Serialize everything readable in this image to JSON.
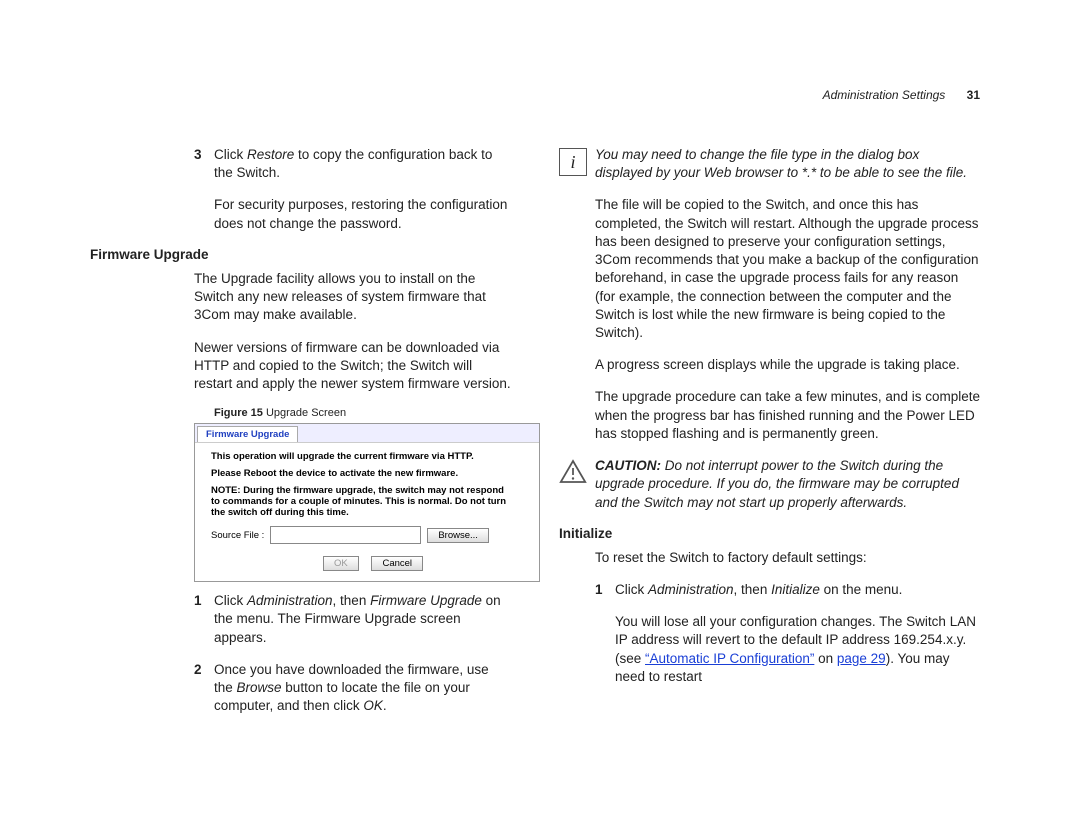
{
  "header": {
    "section": "Administration Settings",
    "page": "31"
  },
  "left": {
    "step3": {
      "n": "3",
      "a": "Click ",
      "b": "Restore",
      "c": " to copy the configuration back to the Switch."
    },
    "step3b": "For security purposes, restoring the configuration does not change the password.",
    "fw_title": "Firmware Upgrade",
    "fw_p1": "The Upgrade facility allows you to install on the Switch any new releases of system firmware that 3Com may make available.",
    "fw_p2": "Newer versions of firmware can be downloaded via HTTP and copied to the Switch; the Switch will restart and apply the newer system firmware version.",
    "fig_cap_a": "Figure 15",
    "fig_cap_b": "   Upgrade Screen",
    "fig": {
      "tab": "Firmware Upgrade",
      "l1": "This operation will upgrade the current firmware via HTTP.",
      "l2": "Please Reboot the device to activate the new firmware.",
      "l3": "NOTE: During the firmware upgrade, the switch may not respond to commands for a couple of minutes. This is normal. Do not turn the switch off during this time.",
      "src_label": "Source File :",
      "browse": "Browse...",
      "ok": "OK",
      "cancel": "Cancel"
    },
    "s1": {
      "n": "1",
      "a": "Click ",
      "b": "Administration",
      "c": ", then ",
      "d": "Firmware Upgrade",
      "e": " on the menu. The Firmware Upgrade screen appears."
    },
    "s2": {
      "n": "2",
      "a": "Once you have downloaded the firmware, use the ",
      "b": "Browse",
      "c": " button to locate the file on your computer, and then click ",
      "d": "OK",
      "e": "."
    }
  },
  "right": {
    "note1": "You may need to change the file type in the dialog box displayed by your Web browser to *.* to be able to see the file.",
    "p1": "The file will be copied to the Switch, and once this has completed, the Switch will restart. Although the upgrade process has been designed to preserve your configuration settings, 3Com recommends that you make a backup of the configuration beforehand, in case the upgrade process fails for any reason (for example, the connection between the computer and the Switch is lost while the new firmware is being copied to the Switch).",
    "p2": "A progress screen displays while the upgrade is taking place.",
    "p3": "The upgrade procedure can take a few minutes, and is complete when the progress bar has finished running and the Power LED has stopped flashing and is permanently green.",
    "caution": {
      "a": "CAUTION:",
      "b": " Do not interrupt power to the Switch during the upgrade procedure. If you do, the firmware may be corrupted and the Switch may not start up properly afterwards."
    },
    "init_title": "Initialize",
    "init_p1": "To reset the Switch to factory default settings:",
    "init_s1": {
      "n": "1",
      "a": "Click ",
      "b": "Administration",
      "c": ", then ",
      "d": "Initialize",
      "e": " on the menu."
    },
    "init_p2a": "You will lose all your configuration changes. The Switch LAN IP address will revert to the default IP address 169.254.x.y. (see ",
    "init_link1": "“Automatic IP Configuration”",
    "init_p2b": " on ",
    "init_link2": "page 29",
    "init_p2c": "). You may need to restart"
  }
}
